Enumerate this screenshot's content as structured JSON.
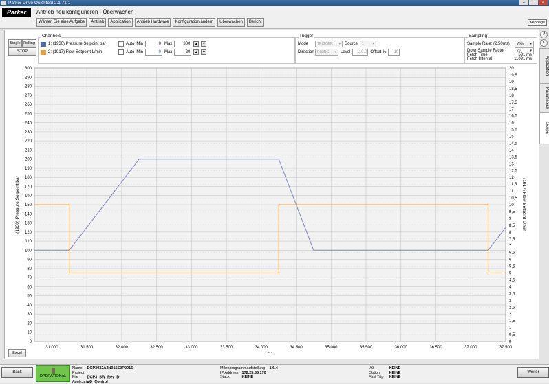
{
  "window": {
    "title": "Parker Drive Quicktool 2.1.71.1"
  },
  "header": {
    "logo": "Parker",
    "subtitle": "Antrieb neu konfigurieren - Überwachen",
    "nav": [
      "Wählen Sie eine Aufgabe",
      "Antrieb",
      "Application",
      "Antrieb Hardware",
      "Konfiguration ändern",
      "Überwachen",
      "Bericht"
    ],
    "webpage": "webpage"
  },
  "scope_controls": {
    "single": "Single",
    "rolling": "Rolling",
    "stop": "STOP",
    "excel": "Excel"
  },
  "channels": {
    "title": "Channels",
    "items": [
      {
        "label": "1:  (1930) Pressure Setpoint bar",
        "color": "#4a6fb0",
        "auto": "Auto",
        "min_label": "Min",
        "min": "0",
        "max_label": "Max",
        "max": "300"
      },
      {
        "label": "2:  (1917) Flow Setpoint L/min",
        "color": "#f0a030",
        "auto": "Auto",
        "min_label": "Min",
        "min": "0",
        "max_label": "Max",
        "max": "20"
      }
    ]
  },
  "trigger": {
    "title": "Trigger",
    "mode_label": "Mode",
    "mode": "TRIGGER",
    "source_label": "Source",
    "source": "1",
    "direction_label": "Direction",
    "direction": "RISING",
    "level_label": "Level",
    "level": "110.0",
    "offset_label": "Offset %",
    "offset": "10"
  },
  "sampling": {
    "title": "Sampling",
    "rate_label": "Sample Rate: (2,50ms)",
    "rate": "WAV",
    "downsample_label": "DownSample Factor",
    "downsample": "20",
    "fetch_time_label": "Fetch Time:",
    "fetch_time": "531 ms",
    "fetch_interval_label": "Fetch Interval:",
    "fetch_interval": "11091 ms"
  },
  "side_tabs": [
    "Application",
    "Parameters",
    "Scope"
  ],
  "chart_data": {
    "type": "line",
    "xlabel": "ms",
    "ylabel": "(1930) Pressure Setpoint bar",
    "y2label": "(1917) Flow Setpoint L/min",
    "xlim": [
      30750,
      37500
    ],
    "ylim": [
      0,
      300
    ],
    "y2lim": [
      0,
      20
    ],
    "x_ticks": [
      "31.000",
      "31.500",
      "32.000",
      "32.500",
      "33.000",
      "33.500",
      "34.000",
      "34.500",
      "35.000",
      "35.500",
      "36.000",
      "36.500",
      "37.000",
      "37.500"
    ],
    "x_tick_values": [
      31000,
      31500,
      32000,
      32500,
      33000,
      33500,
      34000,
      34500,
      35000,
      35500,
      36000,
      36500,
      37000,
      37500
    ],
    "y_ticks": [
      "0",
      "10",
      "20",
      "30",
      "40",
      "50",
      "60",
      "70",
      "80",
      "90",
      "100",
      "110",
      "120",
      "130",
      "140",
      "150",
      "160",
      "170",
      "180",
      "190",
      "200",
      "210",
      "220",
      "230",
      "240",
      "250",
      "260",
      "270",
      "280",
      "290",
      "300"
    ],
    "y2_ticks": [
      "0",
      "0,5",
      "1",
      "1,5",
      "2",
      "2,5",
      "3",
      "3,5",
      "4",
      "4,5",
      "5",
      "5,5",
      "6",
      "6,5",
      "7",
      "7,5",
      "8",
      "8,5",
      "9",
      "9,5",
      "10",
      "10,5",
      "11",
      "11,5",
      "12",
      "12,5",
      "13",
      "13,5",
      "14",
      "14,5",
      "15",
      "15,5",
      "16",
      "16,5",
      "17",
      "17,5",
      "18",
      "18,5",
      "19",
      "19,5",
      "20"
    ],
    "grid": true,
    "series": [
      {
        "name": "(1930) Pressure Setpoint bar",
        "axis": "left",
        "color": "#7f86b8",
        "x": [
          30750,
          31250,
          32250,
          34250,
          34750,
          37250,
          37500
        ],
        "y": [
          100,
          100,
          200,
          200,
          100,
          100,
          125
        ]
      },
      {
        "name": "(1917) Flow Setpoint L/min",
        "axis": "right",
        "color": "#f0a030",
        "x": [
          30750,
          31250,
          31250,
          34250,
          34250,
          37250,
          37250,
          37500
        ],
        "y": [
          10,
          10,
          5,
          5,
          10,
          10,
          5,
          5
        ]
      }
    ]
  },
  "footer": {
    "back": "Back",
    "weiter": "Weiter",
    "status": "OPERATIONAL",
    "name_label": "Name",
    "name": "DCP3032A3N015S0P0016",
    "project_label": "Project File",
    "project": "DCP3_SW_Rev_D",
    "app_label": "Application",
    "app": "pQ_Control",
    "micro_label": "Mikroprogrammaufstellung",
    "micro": "1.6.4",
    "ip_label": "IP Address",
    "ip": "172.25.85.170",
    "stack_label": "Stack",
    "stack": "KEINE",
    "io_label": "I/O",
    "io": "KEINE",
    "option_label": "Option",
    "option": "KEINE",
    "trip_label": "First Trip",
    "trip": "KEINE"
  }
}
